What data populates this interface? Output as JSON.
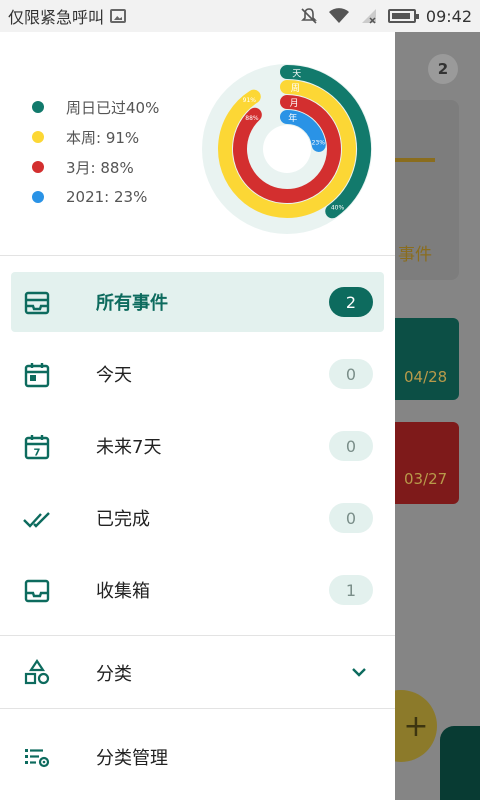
{
  "status_bar": {
    "left_text": "仅限紧急呼叫",
    "time": "09:42",
    "icons": [
      "image-icon",
      "mute-icon",
      "wifi-icon",
      "no-signal-icon",
      "battery-icon"
    ]
  },
  "background": {
    "badge": "2",
    "event_text": "事件",
    "dates": [
      "04/28",
      "03/27"
    ],
    "fab_label": "+"
  },
  "chart": {
    "legend": [
      {
        "label": "周日已过40%",
        "color": "#127a6c"
      },
      {
        "label": "本周: 91%",
        "color": "#fcd735"
      },
      {
        "label": "3月: 88%",
        "color": "#d32f2f"
      },
      {
        "label": "2021: 23%",
        "color": "#2a93e6"
      }
    ],
    "ring_labels": [
      "天",
      "周",
      "月",
      "年"
    ],
    "value_labels": [
      "40%",
      "91%",
      "88%",
      "23%"
    ],
    "values": [
      40,
      91,
      88,
      23
    ]
  },
  "nav": {
    "items": [
      {
        "label": "所有事件",
        "count": "2",
        "icon": "inbox-stack-icon"
      },
      {
        "label": "今天",
        "count": "0",
        "icon": "calendar-today-icon"
      },
      {
        "label": "未来7天",
        "count": "0",
        "icon": "calendar-7-icon"
      },
      {
        "label": "已完成",
        "count": "0",
        "icon": "double-check-icon"
      },
      {
        "label": "收集箱",
        "count": "1",
        "icon": "inbox-icon"
      }
    ],
    "category_label": "分类",
    "category_manage_label": "分类管理"
  },
  "colors": {
    "accent": "#0d6b5e",
    "accent_light": "#e3f1ee",
    "day": "#127a6c",
    "week": "#fcd735",
    "month": "#d32f2f",
    "year": "#2a93e6"
  }
}
